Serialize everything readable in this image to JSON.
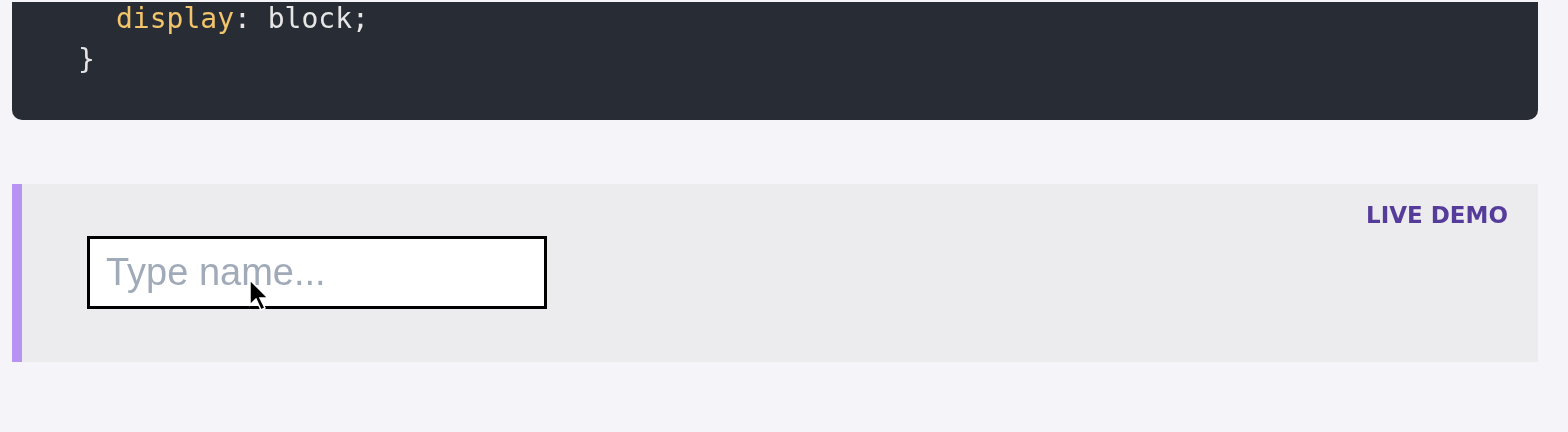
{
  "code_block": {
    "lines": [
      {
        "kind": "nested",
        "parts": [
          {
            "kind": "property",
            "text": "display"
          },
          {
            "kind": "plain",
            "text": ": block;"
          }
        ]
      },
      {
        "kind": "closing",
        "parts": [
          {
            "kind": "plain",
            "text": "}"
          }
        ]
      }
    ]
  },
  "live_demo": {
    "label": "LIVE DEMO",
    "input": {
      "placeholder": "Type name..."
    }
  }
}
